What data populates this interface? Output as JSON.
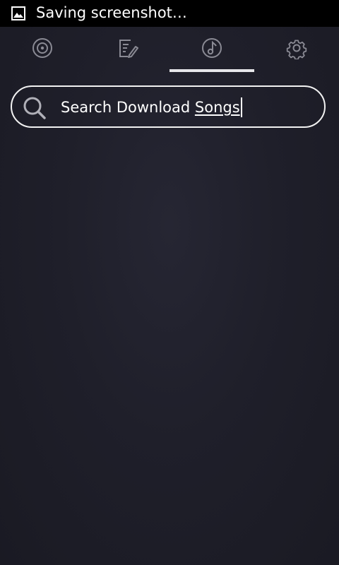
{
  "status_bar": {
    "notification_icon": "image-icon",
    "text": "Saving screenshot…"
  },
  "tabs": [
    {
      "icon": "disc-icon",
      "selected": false
    },
    {
      "icon": "edit-list-icon",
      "selected": false
    },
    {
      "icon": "music-note-icon",
      "selected": true
    },
    {
      "icon": "settings-gear-icon",
      "selected": false
    }
  ],
  "search": {
    "icon": "search-icon",
    "value_prefix": "Search Download ",
    "value_suffix": "Songs"
  },
  "colors": {
    "background": "#1f1f2a",
    "icon_gray": "#8a8a94",
    "selected_indicator": "#e6e6ea",
    "text": "#ffffff"
  }
}
